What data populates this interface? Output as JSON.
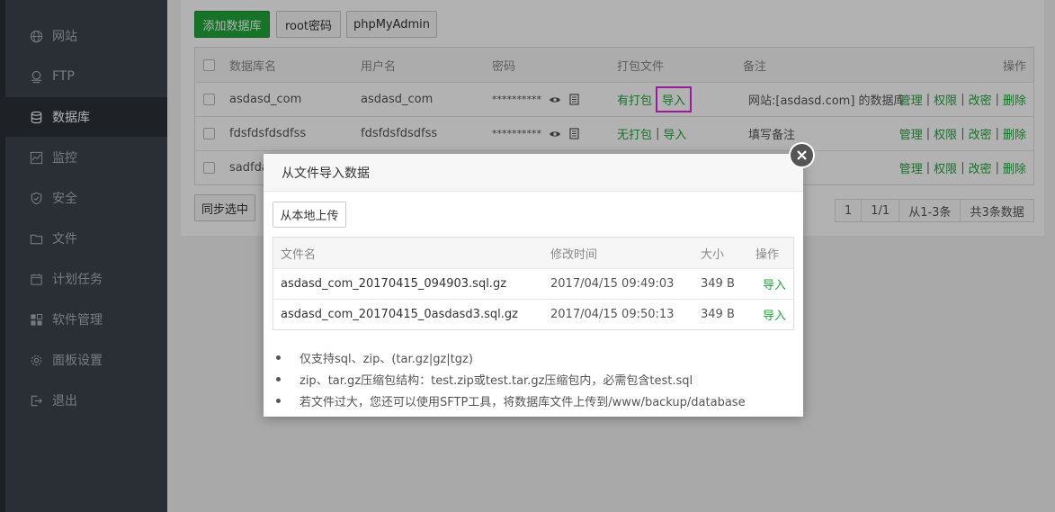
{
  "sidebar": {
    "items": [
      {
        "label": "网站",
        "icon": "globe-icon"
      },
      {
        "label": "FTP",
        "icon": "ftp-icon"
      },
      {
        "label": "数据库",
        "icon": "database-icon",
        "active": true
      },
      {
        "label": "监控",
        "icon": "monitor-icon"
      },
      {
        "label": "安全",
        "icon": "shield-icon"
      },
      {
        "label": "文件",
        "icon": "folder-icon"
      },
      {
        "label": "计划任务",
        "icon": "calendar-icon"
      },
      {
        "label": "软件管理",
        "icon": "apps-icon"
      },
      {
        "label": "面板设置",
        "icon": "gear-icon"
      },
      {
        "label": "退出",
        "icon": "logout-icon"
      }
    ]
  },
  "toolbar": {
    "add_db": "添加数据库",
    "root_pwd": "root密码",
    "phpmyadmin": "phpMyAdmin"
  },
  "db_table": {
    "headers": {
      "name": "数据库名",
      "user": "用户名",
      "password": "密码",
      "backup": "打包文件",
      "remark": "备注",
      "ops": "操作"
    },
    "rows": [
      {
        "name": "asdasd_com",
        "user": "asdasd_com",
        "password": "**********",
        "backup": "有打包",
        "import": "导入",
        "remark": "网站:[asdasd.com] 的数据库"
      },
      {
        "name": "fdsfdsfdsdfss",
        "user": "fdsfdsfdsdfss",
        "password": "**********",
        "backup": "无打包",
        "import": "导入",
        "remark": "填写备注"
      },
      {
        "name": "sadfda",
        "user": "",
        "password": "",
        "backup": "",
        "import": "",
        "remark": ""
      }
    ],
    "ops": {
      "manage": "管理",
      "perm": "权限",
      "change_pwd": "改密",
      "delete": "删除"
    }
  },
  "sync_btn": "同步选中",
  "pager": {
    "page": "1",
    "pages": "1/1",
    "range": "从1-3条",
    "total": "共3条数据"
  },
  "modal": {
    "title": "从文件导入数据",
    "upload_btn": "从本地上传",
    "headers": {
      "filename": "文件名",
      "mtime": "修改时间",
      "size": "大小",
      "ops": "操作"
    },
    "files": [
      {
        "filename": "asdasd_com_20170415_094903.sql.gz",
        "mtime": "2017/04/15 09:49:03",
        "size": "349 B",
        "action": "导入"
      },
      {
        "filename": "asdasd_com_20170415_0asdasd3.sql.gz",
        "mtime": "2017/04/15 09:50:13",
        "size": "349 B",
        "action": "导入"
      }
    ],
    "notes": [
      "仅支持sql、zip、(tar.gz|gz|tgz)",
      "zip、tar.gz压缩包结构：test.zip或test.tar.gz压缩包内，必需包含test.sql",
      "若文件过大，您还可以使用SFTP工具，将数据库文件上传到/www/backup/database"
    ]
  },
  "colors": {
    "accent": "#20a53a",
    "highlight": "#e026e0",
    "sidebar": "#3c444d"
  }
}
